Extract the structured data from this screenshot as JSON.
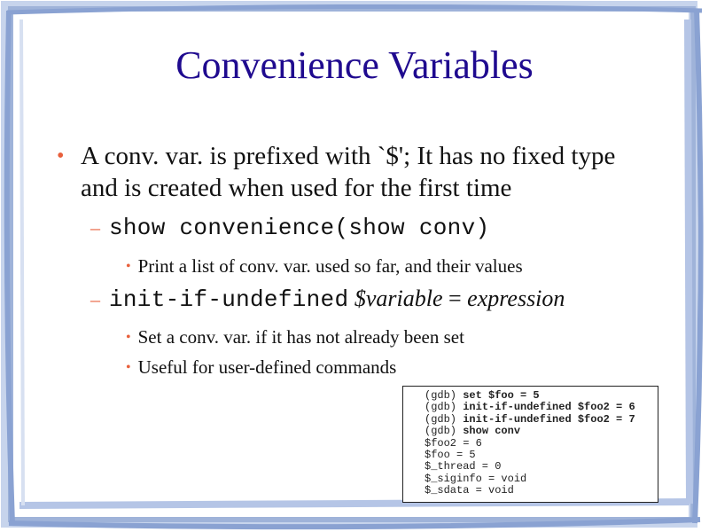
{
  "slide": {
    "title": "Convenience Variables",
    "bullet": "A conv. var. is prefixed with `$'; It has no fixed type and is created when used for the first time",
    "items": [
      {
        "code": "show convenience(show conv)",
        "detail": "Print a list of conv. var. used so far, and their values"
      },
      {
        "code": "init-if-undefined",
        "args_var": "$variable",
        "args_eq": " = ",
        "args_expr": "expression",
        "details": [
          "Set a conv. var. if it has not already been set",
          "Useful for user-defined commands"
        ]
      }
    ],
    "code_example": [
      {
        "prompt": "(gdb) ",
        "cmd": "set $foo = 5"
      },
      {
        "prompt": "(gdb) ",
        "cmd": "init-if-undefined $foo2 = 6"
      },
      {
        "prompt": "(gdb) ",
        "cmd": "init-if-undefined $foo2 = 7"
      },
      {
        "prompt": "(gdb) ",
        "cmd": "show conv"
      },
      {
        "prompt": "$foo2 = 6",
        "cmd": ""
      },
      {
        "prompt": "$foo = 5",
        "cmd": ""
      },
      {
        "prompt": "$_thread = 0",
        "cmd": ""
      },
      {
        "prompt": "$_siginfo = void",
        "cmd": ""
      },
      {
        "prompt": "$_sdata = void",
        "cmd": ""
      }
    ]
  },
  "colors": {
    "title": "#1f0a8f",
    "bullet_marks": "#e8603c",
    "border": "#9fb3d9"
  }
}
